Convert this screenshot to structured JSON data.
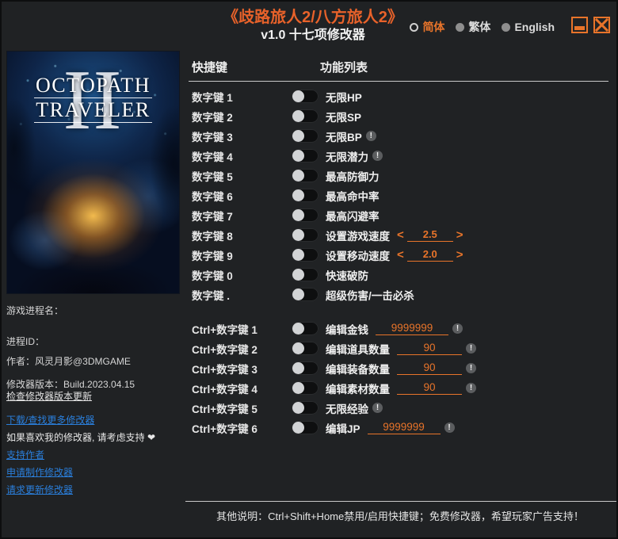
{
  "window": {
    "title": "《歧路旅人2/八方旅人2》",
    "subtitle": "v1.0 十七项修改器",
    "accent_color": "#e8742a",
    "background_color": "#202224"
  },
  "languages": [
    {
      "label": "简体",
      "selected": true
    },
    {
      "label": "繁体",
      "selected": false
    },
    {
      "label": "English",
      "selected": false
    }
  ],
  "window_controls": {
    "minimize": "minimize-icon",
    "close": "close-icon"
  },
  "cover": {
    "numeral": "II",
    "logo_line1": "OCTOPATH",
    "logo_line2": "TRAVELER"
  },
  "sidebar": {
    "process_name_label": "游戏进程名：",
    "process_id_label": "进程ID：",
    "author_label": "作者：风灵月影@3DMGAME",
    "version_label": "修改器版本：Build.2023.04.15",
    "check_update_label": "检查修改器版本更新",
    "download_more_label": "下载/查找更多修改器",
    "support_prompt": "如果喜欢我的修改器, 请考虑支持 ❤",
    "support_author_label": "支持作者",
    "request_make_label": "申请制作修改器",
    "request_update_label": "请求更新修改器"
  },
  "table": {
    "header_key": "快捷键",
    "header_function": "功能列表"
  },
  "cheats": [
    {
      "key": "数字键 1",
      "label": "无限HP",
      "enabled": false,
      "info": false,
      "control": "none"
    },
    {
      "key": "数字键 2",
      "label": "无限SP",
      "enabled": false,
      "info": false,
      "control": "none"
    },
    {
      "key": "数字键 3",
      "label": "无限BP",
      "enabled": false,
      "info": true,
      "control": "none"
    },
    {
      "key": "数字键 4",
      "label": "无限潜力",
      "enabled": false,
      "info": true,
      "control": "none"
    },
    {
      "key": "数字键 5",
      "label": "最高防御力",
      "enabled": false,
      "info": false,
      "control": "none"
    },
    {
      "key": "数字键 6",
      "label": "最高命中率",
      "enabled": false,
      "info": false,
      "control": "none"
    },
    {
      "key": "数字键 7",
      "label": "最高闪避率",
      "enabled": false,
      "info": false,
      "control": "none"
    },
    {
      "key": "数字键 8",
      "label": "设置游戏速度",
      "enabled": false,
      "info": false,
      "control": "spinner",
      "value": "2.5"
    },
    {
      "key": "数字键 9",
      "label": "设置移动速度",
      "enabled": false,
      "info": false,
      "control": "spinner",
      "value": "2.0"
    },
    {
      "key": "数字键 0",
      "label": "快速破防",
      "enabled": false,
      "info": false,
      "control": "none"
    },
    {
      "key": "数字键 .",
      "label": "超级伤害/一击必杀",
      "enabled": false,
      "info": false,
      "control": "none"
    }
  ],
  "cheats_ctrl": [
    {
      "key": "Ctrl+数字键 1",
      "label": "编辑金钱",
      "enabled": false,
      "info": true,
      "control": "field",
      "value": "9999999"
    },
    {
      "key": "Ctrl+数字键 2",
      "label": "编辑道具数量",
      "enabled": false,
      "info": true,
      "control": "field",
      "value": "90"
    },
    {
      "key": "Ctrl+数字键 3",
      "label": "编辑装备数量",
      "enabled": false,
      "info": true,
      "control": "field",
      "value": "90"
    },
    {
      "key": "Ctrl+数字键 4",
      "label": "编辑素材数量",
      "enabled": false,
      "info": true,
      "control": "field",
      "value": "90"
    },
    {
      "key": "Ctrl+数字键 5",
      "label": "无限经验",
      "enabled": false,
      "info": true,
      "control": "none"
    },
    {
      "key": "Ctrl+数字键 6",
      "label": "编辑JP",
      "enabled": false,
      "info": true,
      "control": "field",
      "value": "9999999"
    }
  ],
  "spinner_arrows": {
    "prev": "<",
    "next": ">"
  },
  "info_glyph": "!",
  "footer": {
    "note": "其他说明：Ctrl+Shift+Home禁用/启用快捷键；免费修改器，希望玩家广告支持！"
  }
}
